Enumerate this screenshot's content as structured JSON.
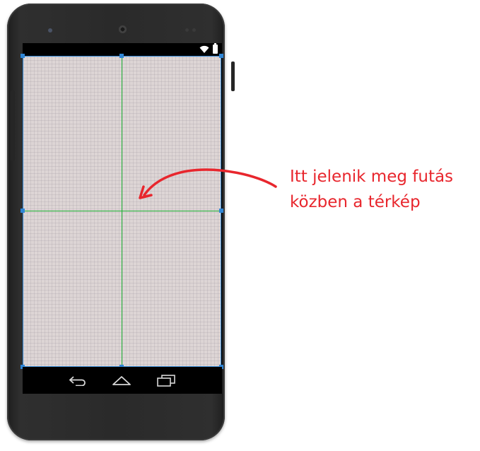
{
  "device": {
    "model": "phone-mockup",
    "status_icons": [
      "wifi-icon",
      "battery-icon"
    ]
  },
  "layout_preview": {
    "content": "map-fragment-placeholder",
    "selection_color": "#2f86d6",
    "guide_color": "#1db234",
    "background_color": "#ddd5d5"
  },
  "navigation": {
    "buttons": [
      "back-icon",
      "home-icon",
      "recents-icon"
    ]
  },
  "annotation": {
    "line1": "Itt jelenik meg futás",
    "line2": "közben a térkép",
    "color": "#e8262d"
  }
}
